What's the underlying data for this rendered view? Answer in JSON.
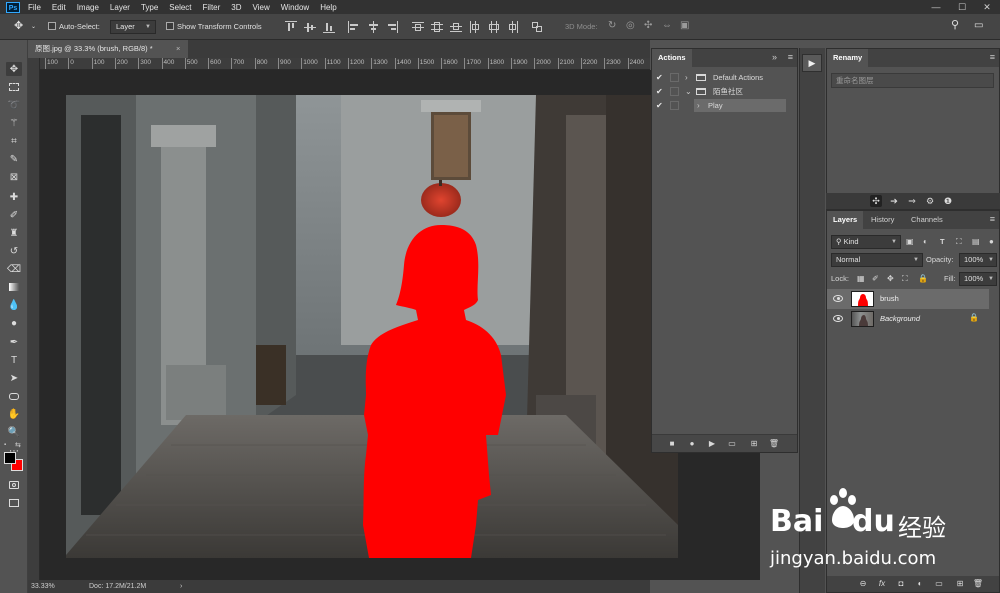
{
  "app": {
    "logo": "Ps"
  },
  "menu": [
    "File",
    "Edit",
    "Image",
    "Layer",
    "Type",
    "Select",
    "Filter",
    "3D",
    "View",
    "Window",
    "Help"
  ],
  "window_controls": {
    "minimize": "—",
    "maximize": "☐",
    "close": "✕"
  },
  "options": {
    "auto_select_label": "Auto-Select:",
    "auto_select_value": "Layer",
    "transform_label": "Show Transform Controls",
    "mode_label": "3D Mode:"
  },
  "document": {
    "tab_title": "原图.jpg @ 33.3% (brush, RGB/8) *",
    "tab_close": "×",
    "ruler_labels": [
      "100",
      "0",
      "100",
      "200",
      "300",
      "400",
      "500",
      "600",
      "700",
      "800",
      "900",
      "1000",
      "1100",
      "1200",
      "1300",
      "1400",
      "1500",
      "1600",
      "1700",
      "1800",
      "1900",
      "2000",
      "2100",
      "2200",
      "2300",
      "2400"
    ],
    "zoom": "33.33%",
    "doc_info": "Doc: 17.2M/21.2M",
    "status_arrow": "›"
  },
  "actions_panel": {
    "tab": "Actions",
    "collapse": "»",
    "menu": "≡",
    "rows": [
      {
        "label": "Default Actions",
        "check": "✔",
        "expand": "›"
      },
      {
        "label": "陌鱼社区",
        "check": "✔",
        "expand": "⌄"
      },
      {
        "label": "Play",
        "check": "✔",
        "expand": "›"
      }
    ],
    "buttons": [
      "■",
      "●",
      "▶",
      "▭",
      "⊞",
      "🗑"
    ]
  },
  "strip": {
    "play": "▶"
  },
  "rename_panel": {
    "tab": "Renamy",
    "menu": "≡",
    "placeholder": "重命名图层",
    "tools": [
      "✣",
      "➔",
      "⇒",
      "⚙",
      "❶"
    ]
  },
  "layers_panel": {
    "tabs": [
      "Layers",
      "History",
      "Channels"
    ],
    "menu": "≡",
    "kind": "Kind",
    "blend_mode": "Normal",
    "opacity_label": "Opacity:",
    "opacity": "100%",
    "lock_label": "Lock:",
    "fill_label": "Fill:",
    "fill": "100%",
    "layers": [
      {
        "name": "brush",
        "selected": true
      },
      {
        "name": "Background",
        "selected": false,
        "locked": true
      }
    ],
    "bottom_buttons": [
      "⊖",
      "fx",
      "◘",
      "◐",
      "▭",
      "⊞",
      "🗑"
    ]
  },
  "watermark": {
    "brand": "Bai",
    "brand2": "du",
    "cn": "经验",
    "url": "jingyan.baidu.com"
  },
  "colors": {
    "foreground": "#000000",
    "background": "#ff0000",
    "mask": "#ff0000"
  }
}
